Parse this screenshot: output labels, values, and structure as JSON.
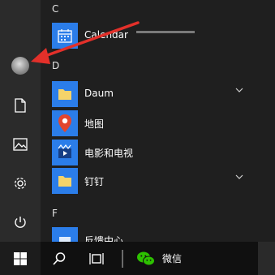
{
  "rail": {
    "items": [
      {
        "name": "user-avatar"
      },
      {
        "name": "documents-icon"
      },
      {
        "name": "pictures-icon"
      },
      {
        "name": "settings-icon"
      },
      {
        "name": "power-icon"
      }
    ]
  },
  "app_list": {
    "sections": [
      {
        "header": "C",
        "apps": [
          {
            "label": "Calendar",
            "icon": "calendar-icon",
            "tile_color": "#2b7de9"
          }
        ]
      },
      {
        "header": "D",
        "apps": [
          {
            "label": "Daum",
            "icon": "folder-icon",
            "tile_color": "#2b7de9",
            "expandable": true
          },
          {
            "label": "地图",
            "icon": "map-pin-icon",
            "tile_color": "#2b7de9"
          },
          {
            "label": "电影和电视",
            "icon": "film-icon",
            "tile_color": "#2b7de9"
          },
          {
            "label": "钉钉",
            "icon": "folder-icon",
            "tile_color": "#2b7de9",
            "expandable": true
          }
        ]
      },
      {
        "header": "F",
        "apps": [
          {
            "label": "反馈中心",
            "icon": "feedback-icon",
            "tile_color": "#2b7de9"
          }
        ]
      }
    ]
  },
  "taskbar": {
    "wechat_label": "微信"
  },
  "colors": {
    "accent": "#2b7de9",
    "arrow": "#e3302a",
    "rail": "#2b2b2b",
    "background": "#1f1f1f",
    "taskbar": "#101010"
  }
}
